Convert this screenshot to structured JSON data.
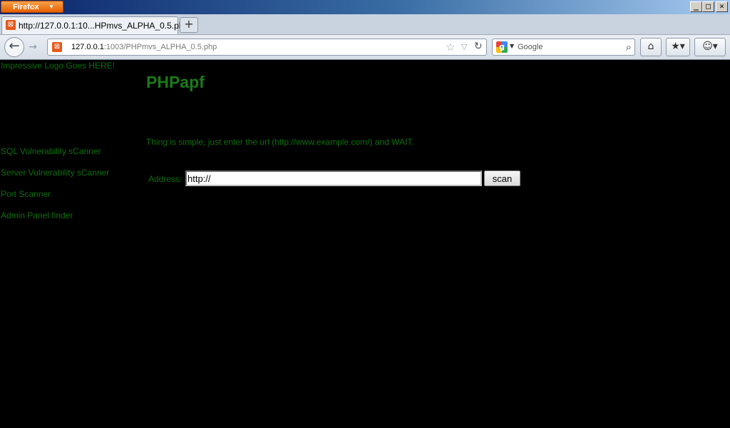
{
  "window": {
    "app_button_label": "Firefox",
    "controls": {
      "minimize": "_",
      "maximize": "□",
      "close": "✕"
    }
  },
  "tabs": [
    {
      "title": "http://127.0.0.1:10...HPmvs_ALPHA_0.5.php",
      "favicon": "xampp-icon"
    }
  ],
  "navbar": {
    "url_host": "127.0.0.1",
    "url_rest": ":1003/PHPmvs_ALPHA_0.5.php",
    "search_placeholder": "Google",
    "search_engine_icon": "google-icon"
  },
  "page": {
    "logo_text": "Impressive Logo Goes HERE!",
    "menu": [
      {
        "label": "SQL Vulnerability sCanner"
      },
      {
        "label": "Server Vulnerability sCanner"
      },
      {
        "label": "Port Scanner"
      },
      {
        "label": "Admin Panel finder"
      }
    ],
    "title": "PHPapf",
    "intro": "Thing is simple, just enter the url (http://www.example.com/) and WAIT.",
    "form": {
      "address_label": "Address:",
      "address_value": "http://",
      "scan_label": "scan"
    }
  },
  "colors": {
    "page_bg": "#000000",
    "text_green": "#0f6e0f",
    "heading_green": "#1a7a1a",
    "firefox_orange": "#e66000"
  }
}
